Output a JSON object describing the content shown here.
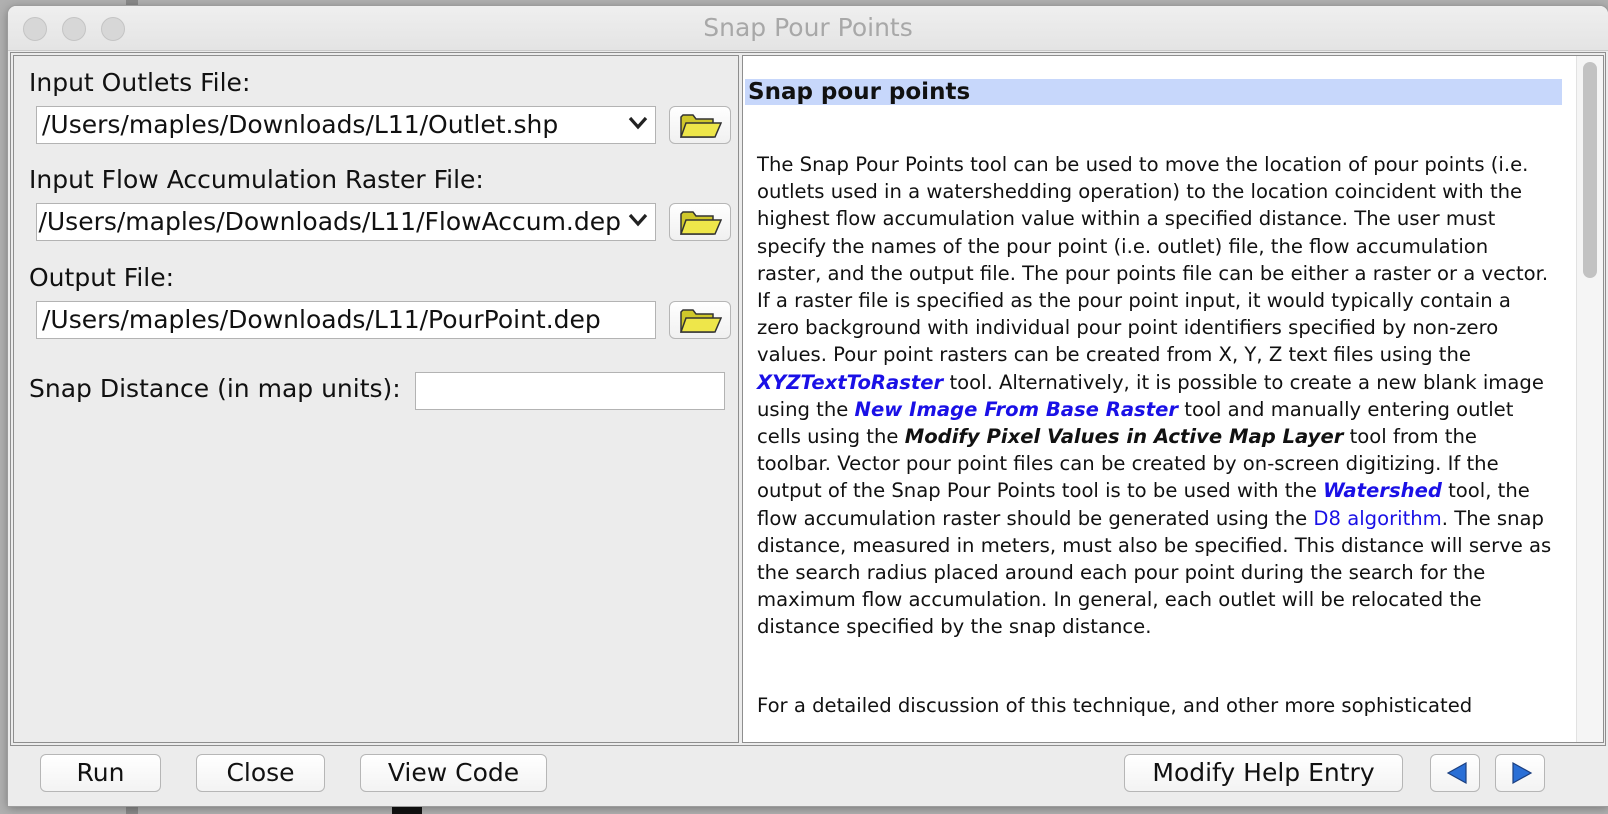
{
  "window": {
    "title": "Snap Pour Points"
  },
  "form": {
    "outlets_label": "Input Outlets File:",
    "outlets_value": "/Users/maples/Downloads/L11/Outlet.shp",
    "flowacc_label": "Input Flow Accumulation Raster File:",
    "flowacc_value": "/Users/maples/Downloads/L11/FlowAccum.dep",
    "output_label": "Output File:",
    "output_value": "/Users/maples/Downloads/L11/PourPoint.dep",
    "snap_label": "Snap Distance (in map units):",
    "snap_value": ""
  },
  "help": {
    "heading": "Snap pour points",
    "s1": "The Snap Pour Points tool can be used to move the location of pour points (i.e. outlets used in a watershedding operation) to the location coincident with the highest flow accumulation value within a specified distance. The user must specify the names of the pour point (i.e. outlet) file, the flow accumulation raster, and the output file. The pour points file can be either a raster or a vector. If a raster file is specified as the pour point input, it would typically contain a zero background with individual pour point identifiers specified by non-zero values. Pour point rasters can be created from X, Y, Z text files using the ",
    "link_xyz": "XYZTextToRaster",
    "s2": " tool. Alternatively, it is possible to create a new blank image using the ",
    "link_newimage": "New Image From Base Raster",
    "s3": " tool and manually entering outlet cells using the ",
    "emph_modify": "Modify Pixel Values in Active Map Layer",
    "s4": " tool from the toolbar. Vector pour point files can be created by on-screen digitizing. If the output of the Snap Pour Points tool is to be used with the ",
    "link_watershed": "Watershed",
    "s5": " tool, the flow accumulation raster should be generated using the ",
    "link_d8": "D8 algorithm",
    "s6": ". The snap distance, measured in meters, must also be specified. This distance will serve as the search radius placed around each pour point during the search for the maximum flow accumulation. In general, each outlet will be relocated the distance specified by the snap distance.",
    "p2": "For a detailed discussion of this technique, and other more sophisticated"
  },
  "buttons": {
    "run": "Run",
    "close": "Close",
    "view_code": "View Code",
    "modify_help": "Modify Help Entry"
  },
  "icons": {
    "folder": "folder-open-icon",
    "back": "left-arrow-icon",
    "forward": "right-arrow-icon",
    "dropdown": "chevron-down-icon"
  },
  "colors": {
    "heading_bg": "#c7d7fb",
    "link": "#1a10e6",
    "nav_arrow": "#2a6fd6",
    "folder": "#e5dd3c"
  }
}
